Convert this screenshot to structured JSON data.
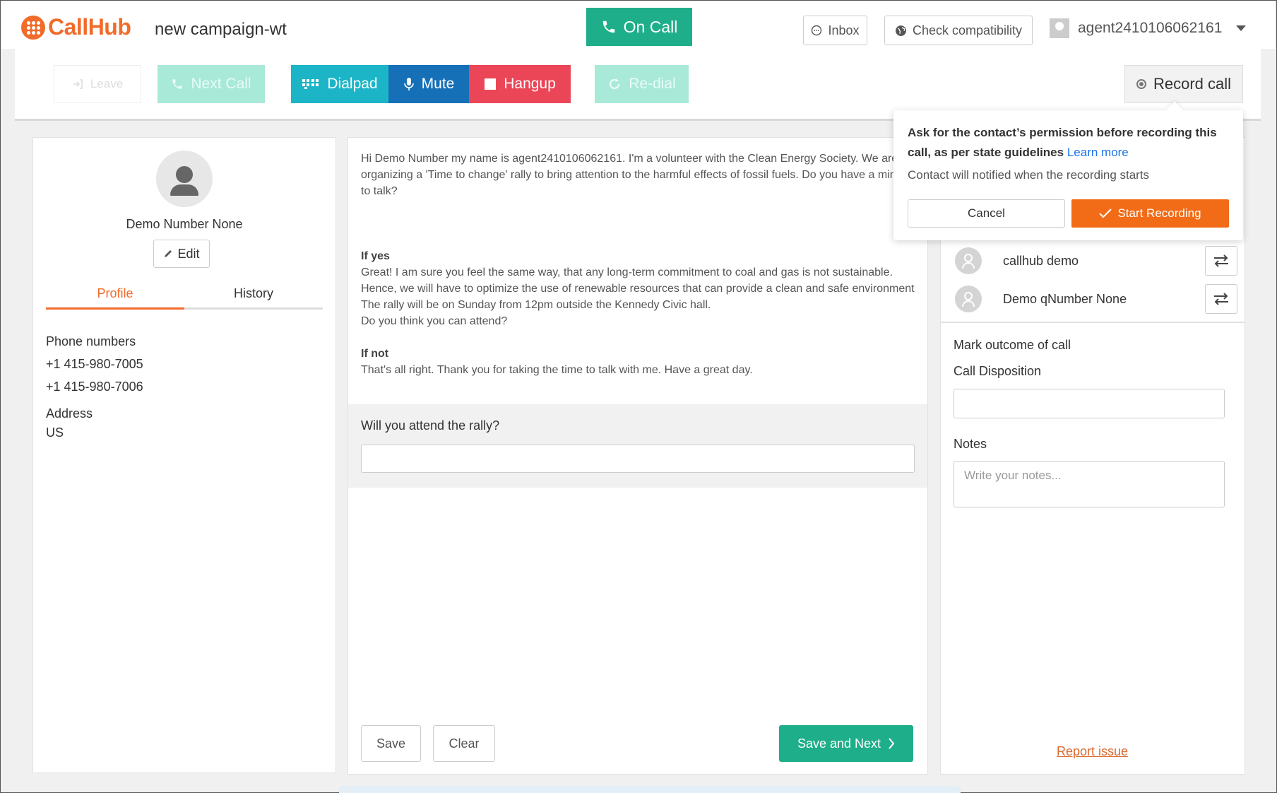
{
  "header": {
    "logo_text": "CallHub",
    "campaign": "new campaign-wt",
    "on_call_label": "On Call",
    "inbox_label": "Inbox",
    "check_compat_label": "Check compatibility",
    "agent_name": "agent2410106062161"
  },
  "toolbar": {
    "leave_label": "Leave",
    "next_call_label": "Next Call",
    "dialpad_label": "Dialpad",
    "mute_label": "Mute",
    "hangup_label": "Hangup",
    "redial_label": "Re-dial",
    "record_call_label": "Record call"
  },
  "contact": {
    "name": "Demo Number None",
    "edit_label": "Edit",
    "tabs": [
      {
        "label": "Profile"
      },
      {
        "label": "History"
      }
    ],
    "phone_heading": "Phone numbers",
    "phones": [
      "+1 415-980-7005",
      "+1 415-980-7006"
    ],
    "address_heading": "Address",
    "address": "US"
  },
  "script": {
    "intro": "Hi Demo Number my name is agent2410106062161. I'm a volunteer with the Clean Energy Society. We are organizing a 'Time to change' rally to bring attention to the harmful effects of fossil fuels. Do you have a minute to talk?",
    "if_yes_heading": "If yes",
    "if_yes_line1": "Great! I am sure you feel the same way, that any long-term commitment to coal and gas is not sustainable. Hence, we will have to optimize the use of renewable resources that can provide a clean and safe environment",
    "if_yes_line2": "The rally will be on Sunday from 12pm outside the Kennedy Civic hall.",
    "if_yes_line3": "Do you think you can attend?",
    "if_not_heading": "If not",
    "if_not_text": "That's all right. Thank you for taking the time to talk with me. Have a great day."
  },
  "survey": {
    "question": "Will you attend the rally?",
    "answer_value": ""
  },
  "footer": {
    "save_label": "Save",
    "clear_label": "Clear",
    "save_next_label": "Save and Next"
  },
  "right": {
    "contacts": [
      {
        "name": "callhub demo"
      },
      {
        "name": "Demo qNumber None"
      }
    ],
    "mark_outcome_label": "Mark outcome of call",
    "disposition_label": "Call Disposition",
    "notes_label": "Notes",
    "notes_placeholder": "Write your notes...",
    "report_issue_label": "Report issue"
  },
  "popover": {
    "message": "Ask for the contact’s permission before recording this call, as per state guidelines",
    "learn_more": "Learn more",
    "subtext": "Contact will notified when the recording starts",
    "cancel_label": "Cancel",
    "start_label": "Start Recording"
  },
  "colors": {
    "brand": "#f26b2a",
    "on_call": "#1fae8a",
    "dialpad": "#1bb5c7",
    "mute": "#1670b8",
    "hangup": "#ea4657",
    "start_recording": "#f26b16",
    "link": "#1a73e8"
  },
  "icons": [
    "callhub-logo-icon",
    "phone-icon",
    "chat-bubble-icon",
    "globe-icon",
    "user-avatar-icon",
    "chevron-down-icon",
    "leave-icon",
    "dialpad-icon",
    "microphone-icon",
    "stop-icon",
    "redo-icon",
    "radio-icon",
    "pencil-icon",
    "transfer-icon",
    "chevron-right-icon",
    "check-icon"
  ]
}
